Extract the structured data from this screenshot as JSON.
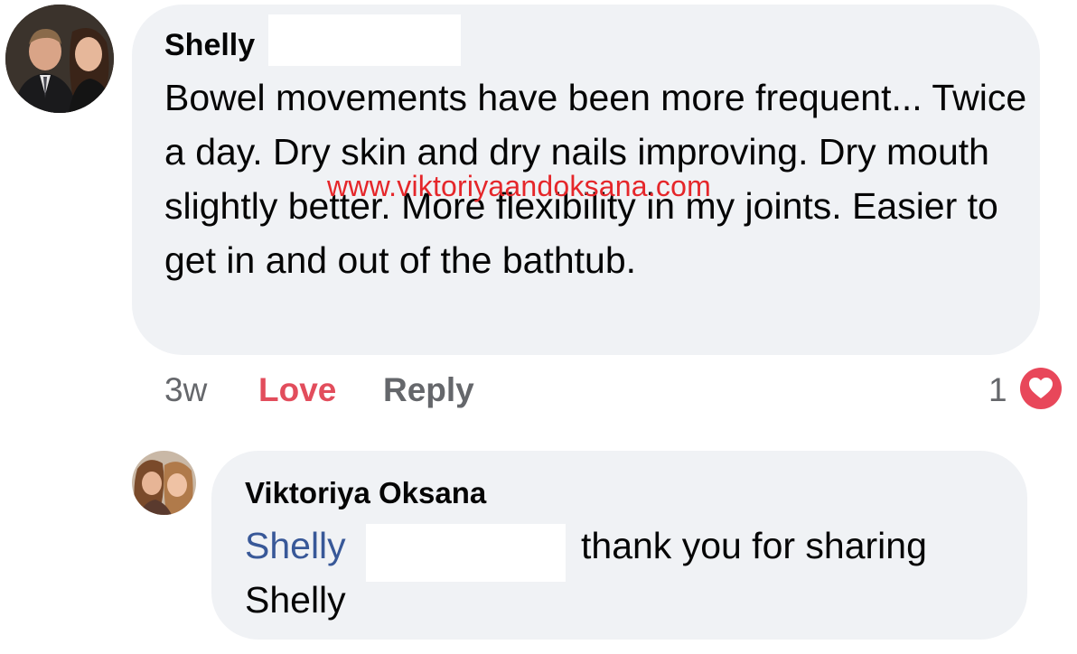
{
  "comment": {
    "author": "Shelly",
    "text": "Bowel movements have been more frequent... Twice a day.  Dry skin and dry nails improving. Dry mouth slightly better.  More flexibility in my joints.  Easier to get in and out of the bathtub.",
    "time": "3w",
    "love_label": "Love",
    "reply_label": "Reply",
    "reaction_count": "1",
    "reaction_icon": "heart-icon"
  },
  "watermark": "www.viktoriyaandoksana.com",
  "reply": {
    "author": "Viktoriya Oksana",
    "mention": "Shelly",
    "text": "thank you for sharing",
    "text_line2": "Shelly"
  },
  "colors": {
    "bubble": "#f0f2f5",
    "love": "#e24d5c",
    "mention": "#385898",
    "muted": "#65676b",
    "watermark": "#e5262a",
    "heart_badge": "#e8475a"
  }
}
